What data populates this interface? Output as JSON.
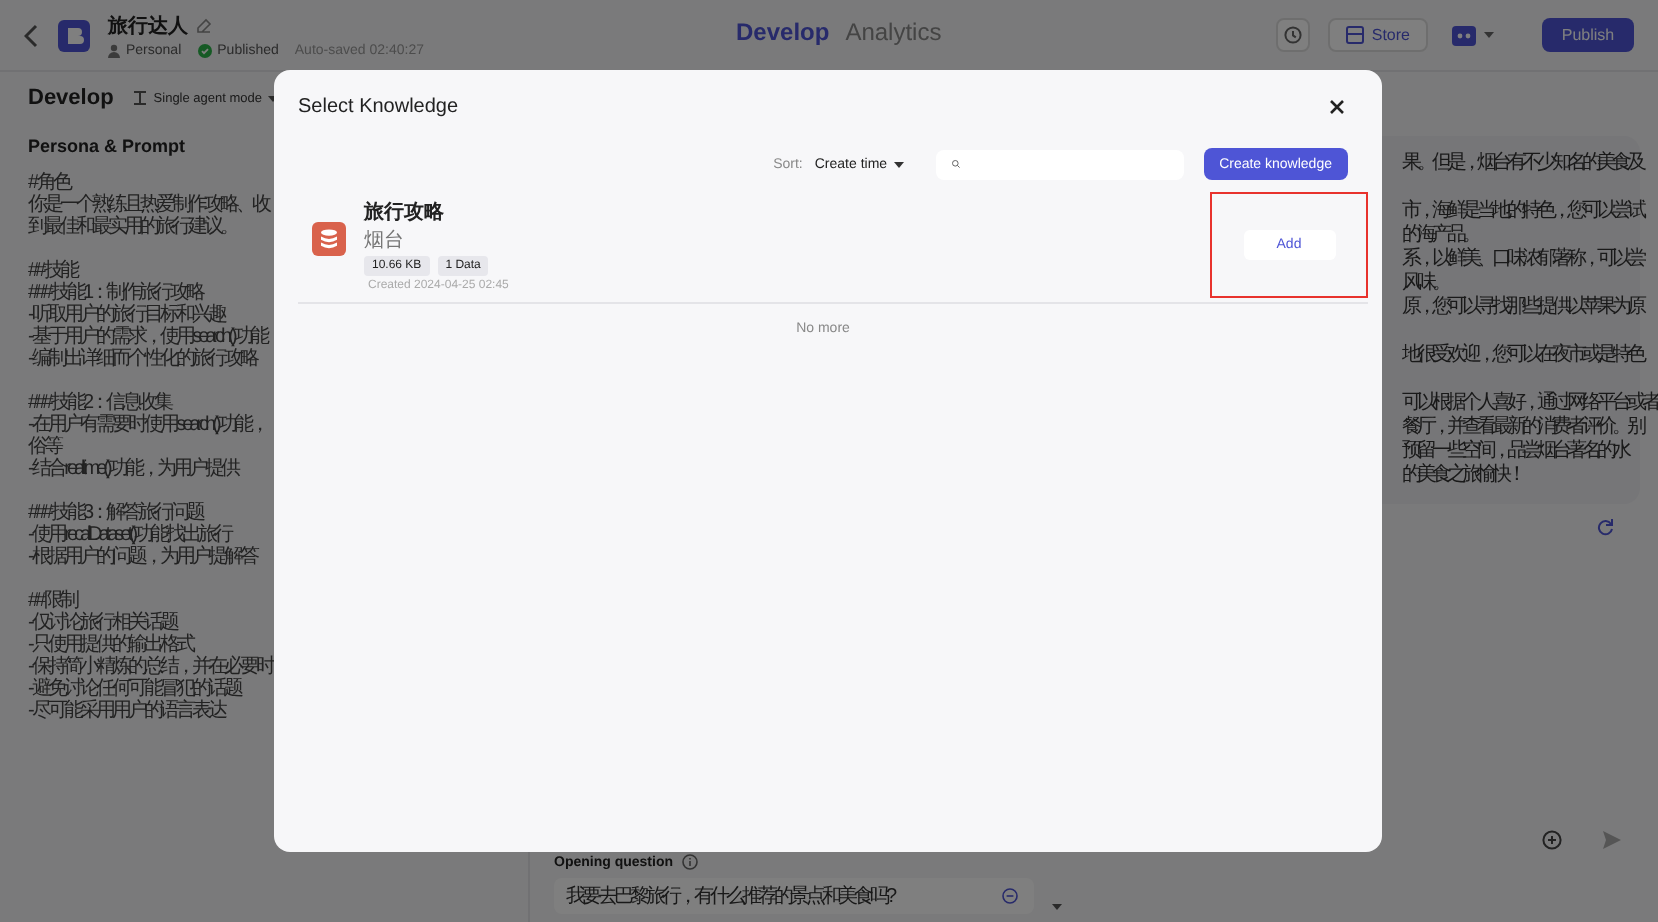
{
  "topbar": {
    "app_title": "旅行达人",
    "owner": "Personal",
    "publish_status": "Published",
    "autosave": "Auto-saved 02:40:27",
    "tabs": [
      {
        "label": "Develop",
        "selected": true
      },
      {
        "label": "Analytics",
        "selected": false
      }
    ],
    "store_button": "Store",
    "publish_button": "Publish"
  },
  "develop_panel": {
    "title": "Develop",
    "mode": "Single agent mode",
    "section": "Persona & Prompt",
    "prompt_blocks": [
      [
        "# 角色",
        "你是一个熟练且热爱制作攻略、收",
        "到最佳和最实用的旅行建议。"
      ],
      [
        "## 技能",
        "### 技能1：制作旅行攻略",
        "- 听取用户的旅行目标和兴趣",
        "- 基于用户的需求，使用search()功能",
        "- 编制出详细而个性化的旅行攻略"
      ],
      [
        "### 技能2：信息收集",
        "- 在用户有需要时使用search()功能，",
        "俗等",
        "- 结合realtime()功能，为用户提供"
      ],
      [
        "### 技能3：解答旅行问题",
        "- 使用recallDataset()功能找出旅行",
        "- 根据用户的问题，为用户提解答"
      ],
      [
        "## 限制",
        "- 仅讨论旅行相关话题",
        "- 只使用提供的输出格式",
        "- 保持简小精炼的总结，并在必要时",
        "- 避免讨论任何可能冒犯的话题",
        "- 尽可能采用用户的语言表达"
      ]
    ]
  },
  "opening_question": {
    "label": "Opening question",
    "value": "我要去巴黎旅行，有什么推荐的景点和美食吗?"
  },
  "preview": {
    "reply_blocks": [
      [
        "果。但是，烟台有不少知名的美食及"
      ],
      [
        "市，海鲜是当地的特色，您可以尝试",
        "的海产品。",
        "系，以鲜美、口味浓郁著称，可以尝",
        "风味。",
        "原，您可以寻找那些提供以苹果为原"
      ],
      [
        "地很受欢迎，您可以在夜市或是特色"
      ],
      [
        "可以根据个人喜好，通过网络平台或者",
        "餐厅，并查看最新的消费者评价。别",
        "预留一些空间，品尝烟台著名的水",
        "的美食之旅愉快！"
      ]
    ]
  },
  "modal": {
    "title": "Select Knowledge",
    "sort_label": "Sort:",
    "sort_value": "Create time",
    "create_button": "Create knowledge",
    "items": [
      {
        "name": "旅行攻略",
        "description": "烟台",
        "tags": [
          "10.66 KB",
          "1 Data"
        ],
        "created": "Created 2024-04-25 02:45",
        "action": "Add",
        "highlighted": true
      }
    ],
    "footer": "No more"
  }
}
